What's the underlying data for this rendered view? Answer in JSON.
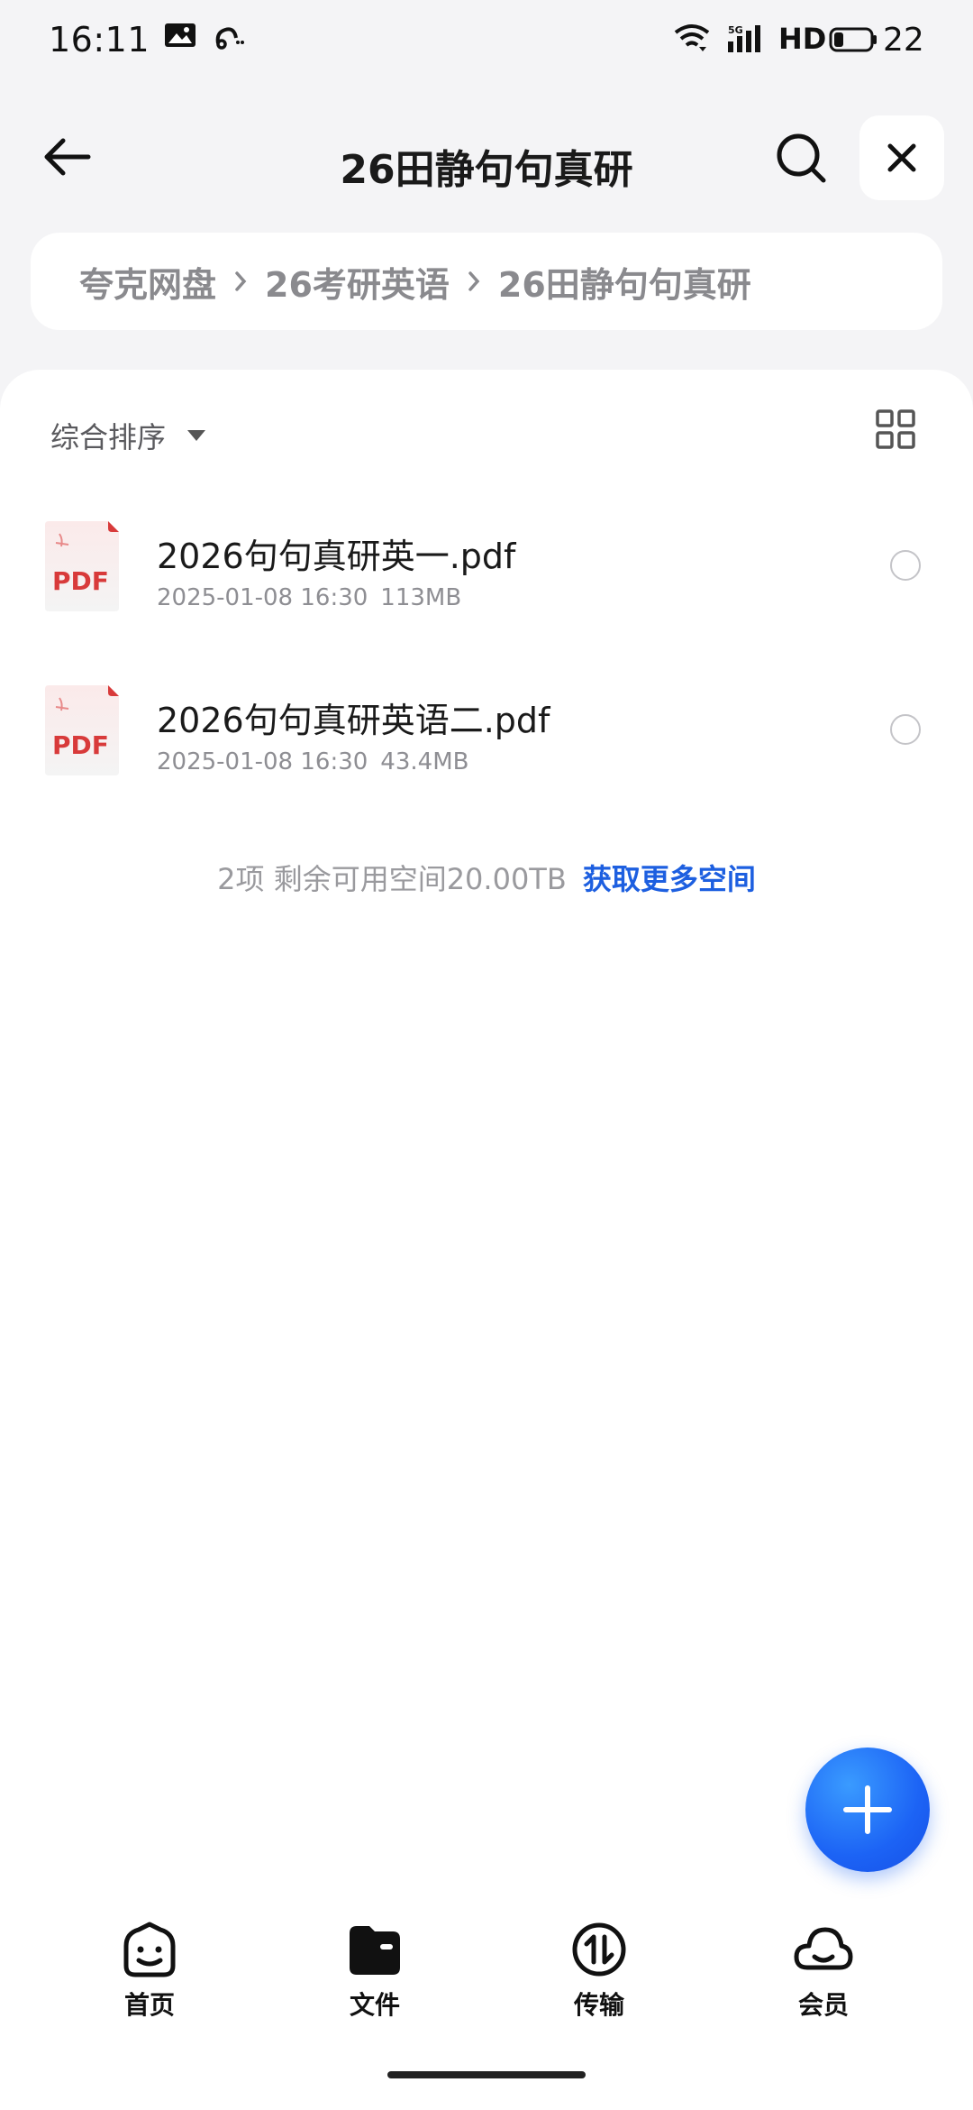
{
  "status_bar": {
    "time": "16:11",
    "network": "5G",
    "hd": "HD",
    "battery": "22",
    "icons": [
      "gallery-icon",
      "link-icon",
      "wifi-icon",
      "signal-icon",
      "battery-icon"
    ]
  },
  "header": {
    "title": "26田静句句真研",
    "icons": [
      "back-arrow-icon",
      "search-icon",
      "close-icon"
    ]
  },
  "breadcrumb": [
    {
      "label": "夸克网盘"
    },
    {
      "label": "26考研英语"
    },
    {
      "label": "26田静句句真研"
    }
  ],
  "toolbar": {
    "sort_label": "综合排序",
    "view_icon": "grid-view-icon"
  },
  "files": [
    {
      "name": "2026句句真研英一.pdf",
      "date": "2025-01-08 16:30",
      "size": "113MB",
      "type_label": "PDF",
      "selected": false
    },
    {
      "name": "2026句句真研英语二.pdf",
      "date": "2025-01-08 16:30",
      "size": "43.4MB",
      "type_label": "PDF",
      "selected": false
    }
  ],
  "footer": {
    "info": "2项 剩余可用空间20.00TB",
    "more_link": "获取更多空间"
  },
  "fab": {
    "icon": "plus-icon"
  },
  "bottom_nav": [
    {
      "label": "首页",
      "icon": "home-face-icon",
      "active": false
    },
    {
      "label": "文件",
      "icon": "folder-icon",
      "active": true
    },
    {
      "label": "传输",
      "icon": "transfer-icon",
      "active": false
    },
    {
      "label": "会员",
      "icon": "cloud-icon",
      "active": false
    }
  ],
  "colors": {
    "accent": "#1d5fe0",
    "pdf_red": "#d83a3a",
    "background": "#f4f4f6"
  }
}
